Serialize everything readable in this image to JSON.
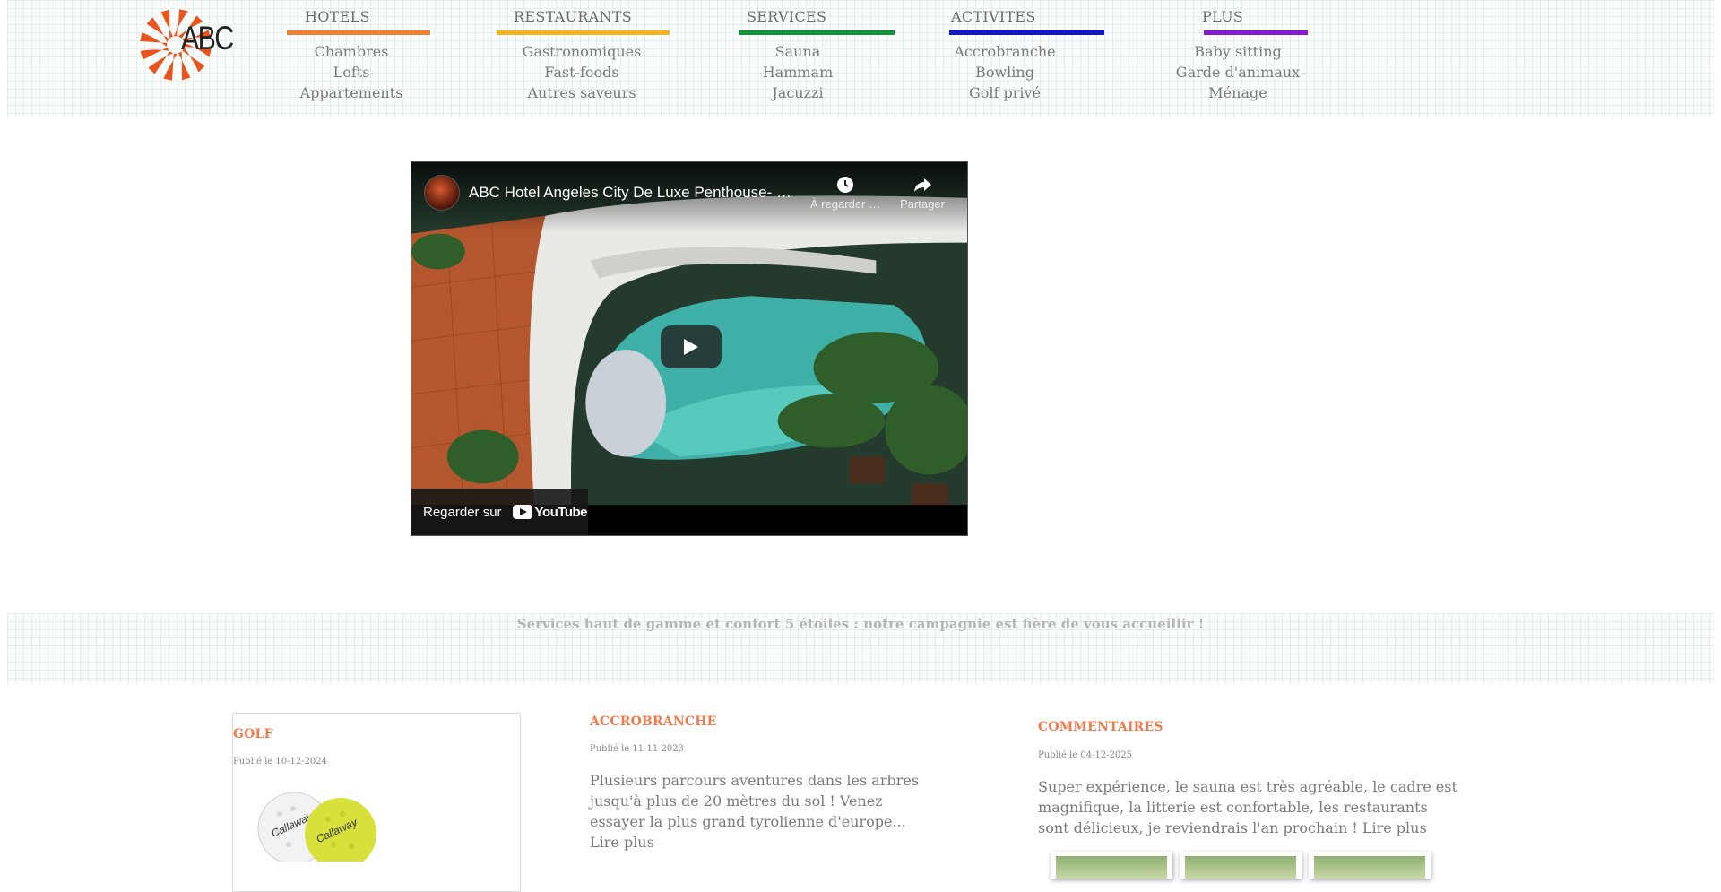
{
  "brand": {
    "logo_text": "ABC",
    "logo_color": "#e8541c"
  },
  "nav": [
    {
      "title": "HOTELS",
      "color": "#f08034",
      "items": [
        "Chambres",
        "Lofts",
        "Appartements"
      ]
    },
    {
      "title": "RESTAURANTS",
      "color": "#f5b324",
      "items": [
        "Gastronomiques",
        "Fast-foods",
        "Autres saveurs"
      ]
    },
    {
      "title": "SERVICES",
      "color": "#12943a",
      "items": [
        "Sauna",
        "Hammam",
        "Jacuzzi"
      ]
    },
    {
      "title": "ACTIVITES",
      "color": "#1414c8",
      "items": [
        "Accrobranche",
        "Bowling",
        "Golf privé"
      ]
    },
    {
      "title": "PLUS",
      "color": "#8a1ad0",
      "items": [
        "Baby sitting",
        "Garde d'animaux",
        "Ménage"
      ]
    }
  ],
  "video": {
    "title": "ABC Hotel Angeles City De Luxe Penthouse- …",
    "watch_later_label": "À regarder …",
    "share_label": "Partager",
    "watch_on_label": "Regarder sur",
    "platform_label": "YouTube"
  },
  "tagline": "Services haut de gamme et confort 5 étoiles : notre campagnie est fière de vous accueillir !",
  "posts": {
    "golf": {
      "title": "GOLF",
      "date": "Publié le 10-12-2024"
    },
    "accro": {
      "title": "ACCROBRANCHE",
      "date": "Publié le 11-11-2023",
      "lines": [
        "Plusieurs parcours aventures dans les arbres",
        "jusqu'à plus de 20 mètres du sol ! Venez",
        "essayer la plus grand tyrolienne d'europe...",
        "Lire plus"
      ]
    },
    "comments": {
      "title": "COMMENTAIRES",
      "date": "Publié le 04-12-2025",
      "lines": [
        "Super expérience, le sauna est très agréable, le cadre est",
        "magnifique, la litterie est confortable, les restaurants",
        "sont délicieux, je reviendrais l'an prochain ! Lire plus"
      ]
    }
  }
}
